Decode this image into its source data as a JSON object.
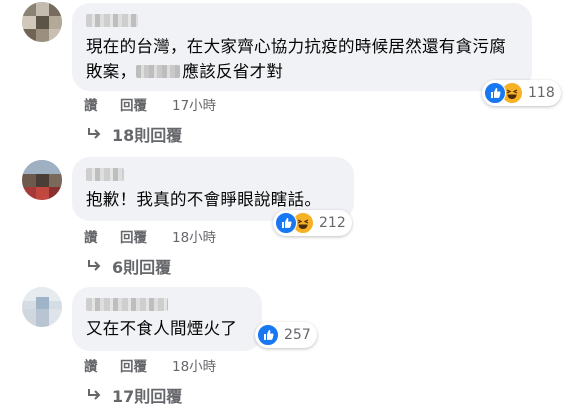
{
  "comments": [
    {
      "lines": [
        "現在的台灣，在大家齊心協力抗疫的時候居然還有貪污腐",
        "敗案，",
        "應該反省才對"
      ],
      "reaction_count": "118",
      "reactions": [
        "like-icon",
        "haha-icon"
      ],
      "actions": {
        "like": "讚",
        "reply": "回覆",
        "time": "17小時"
      },
      "replies_label": "18則回覆"
    },
    {
      "lines": [
        "抱歉！我真的不會睜眼說瞎話。"
      ],
      "reaction_count": "212",
      "reactions": [
        "like-icon",
        "haha-icon"
      ],
      "actions": {
        "like": "讚",
        "reply": "回覆",
        "time": "18小時"
      },
      "replies_label": "6則回覆"
    },
    {
      "lines": [
        "又在不食人間煙火了"
      ],
      "reaction_count": "257",
      "reactions": [
        "like-icon"
      ],
      "actions": {
        "like": "讚",
        "reply": "回覆",
        "time": "18小時"
      },
      "replies_label": "17則回覆"
    }
  ],
  "colors": {
    "bubble": "#f0f2f5",
    "like": "#1877f2",
    "haha": "#f7b125",
    "meta": "#65676b"
  }
}
